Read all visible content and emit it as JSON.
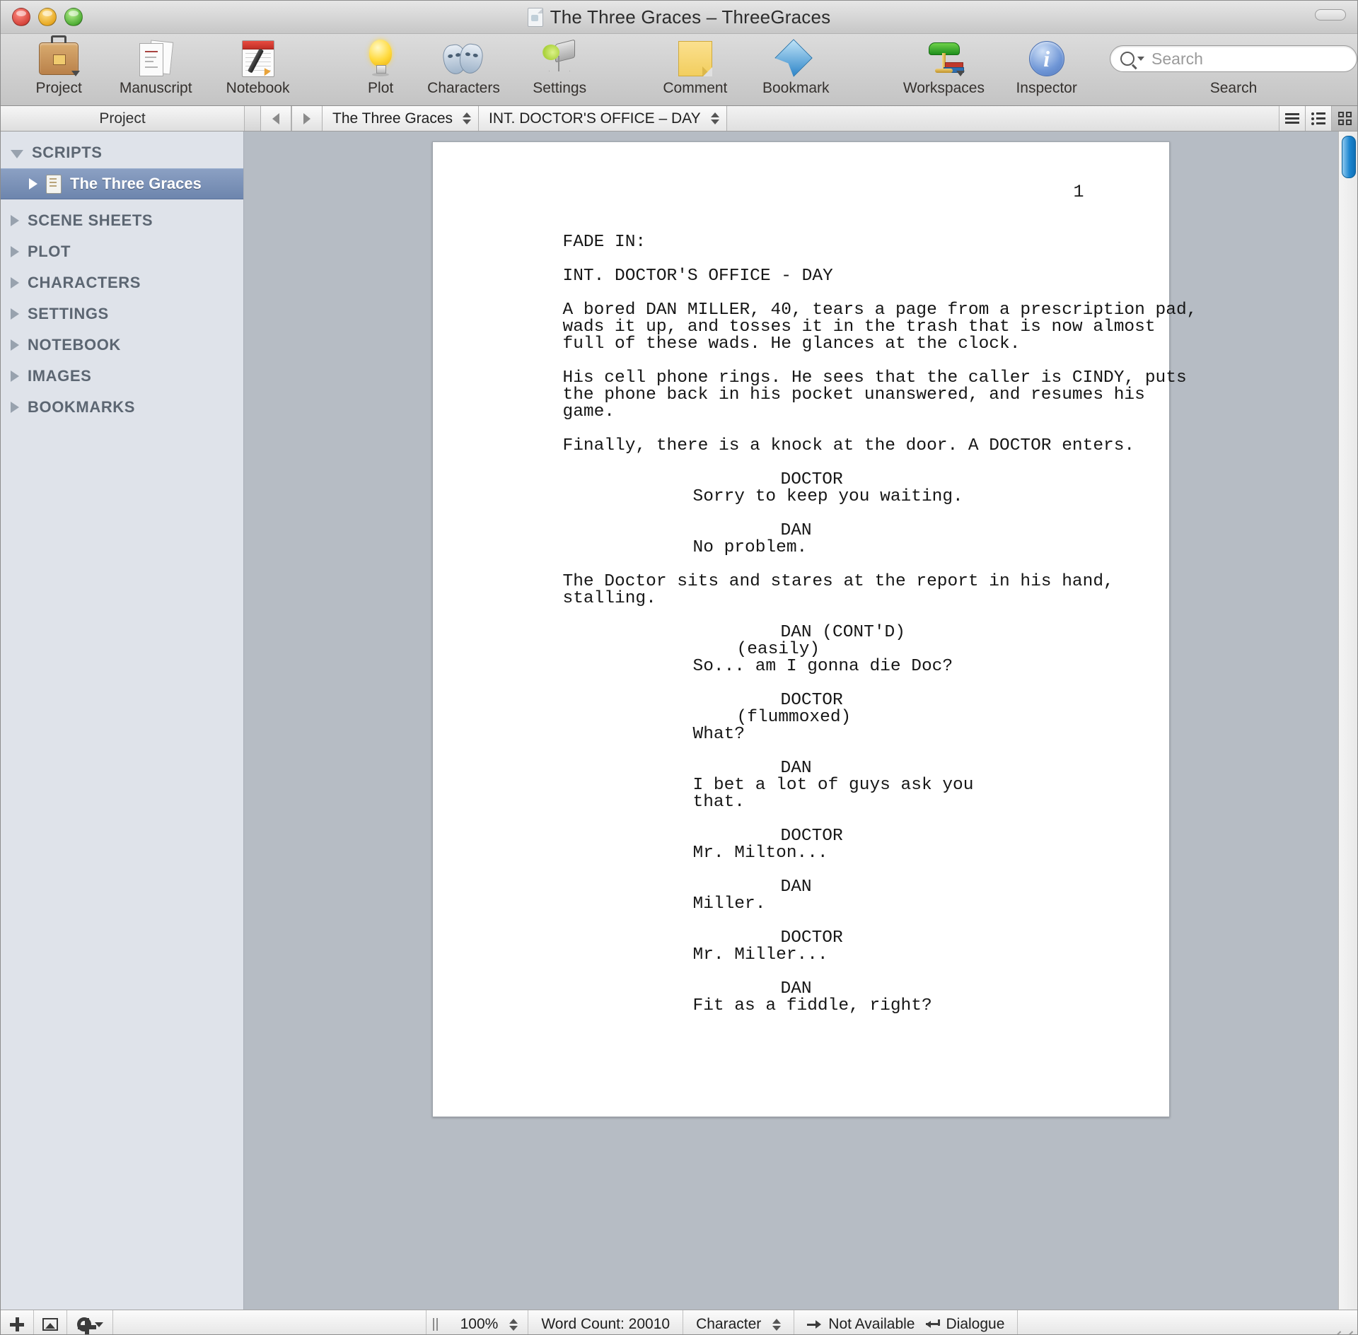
{
  "window": {
    "title": "The Three Graces – ThreeGraces",
    "controls": [
      "close",
      "minimize",
      "zoom"
    ]
  },
  "toolbar": {
    "items": [
      {
        "label": "Project",
        "icon": "briefcase-icon",
        "has_menu": true
      },
      {
        "label": "Manuscript",
        "icon": "manuscript-icon",
        "has_menu": false
      },
      {
        "label": "Notebook",
        "icon": "notebook-icon",
        "has_menu": false
      },
      {
        "label": "Plot",
        "icon": "lightbulb-icon",
        "has_menu": false
      },
      {
        "label": "Characters",
        "icon": "masks-icon",
        "has_menu": false
      },
      {
        "label": "Settings",
        "icon": "stage-light-icon",
        "has_menu": false
      },
      {
        "label": "Comment",
        "icon": "sticky-note-icon",
        "has_menu": false
      },
      {
        "label": "Bookmark",
        "icon": "bookmark-icon",
        "has_menu": false
      },
      {
        "label": "Workspaces",
        "icon": "desk-lamp-icon",
        "has_menu": true
      },
      {
        "label": "Inspector",
        "icon": "info-icon",
        "has_menu": false
      }
    ],
    "search": {
      "label": "Search",
      "placeholder": "Search",
      "value": "",
      "icon": "search-icon"
    }
  },
  "sidebar": {
    "header": "Project",
    "groups": [
      {
        "label": "SCRIPTS",
        "expanded": true,
        "selected_child": "The Three Graces"
      },
      {
        "label": "SCENE SHEETS",
        "expanded": false
      },
      {
        "label": "PLOT",
        "expanded": false
      },
      {
        "label": "CHARACTERS",
        "expanded": false
      },
      {
        "label": "SETTINGS",
        "expanded": false
      },
      {
        "label": "NOTEBOOK",
        "expanded": false
      },
      {
        "label": "IMAGES",
        "expanded": false
      },
      {
        "label": "BOOKMARKS",
        "expanded": false
      }
    ],
    "script_item": "The Three Graces"
  },
  "navbar": {
    "back_icon": "chevron-left-icon",
    "forward_icon": "chevron-right-icon",
    "document_popup": "The Three Graces",
    "scene_popup": "INT. DOCTOR'S OFFICE – DAY",
    "view_modes": [
      {
        "name": "page-view",
        "active": false
      },
      {
        "name": "outline-view",
        "active": false
      },
      {
        "name": "index-card-view",
        "active": true
      }
    ]
  },
  "editor": {
    "page_number": "1",
    "script": [
      {
        "type": "trans",
        "text": "FADE IN:"
      },
      {
        "type": "slug",
        "text": "INT. DOCTOR'S OFFICE - DAY"
      },
      {
        "type": "action",
        "text": "A bored DAN MILLER, 40, tears a page from a prescription pad,\nwads it up, and tosses it in the trash that is now almost\nfull of these wads. He glances at the clock."
      },
      {
        "type": "action",
        "text": "His cell phone rings. He sees that the caller is CINDY, puts\nthe phone back in his pocket unanswered, and resumes his\ngame."
      },
      {
        "type": "action",
        "text": "Finally, there is a knock at the door. A DOCTOR enters."
      },
      {
        "type": "cue",
        "text": "DOCTOR"
      },
      {
        "type": "dial",
        "text": "Sorry to keep you waiting."
      },
      {
        "type": "cue",
        "text": "DAN"
      },
      {
        "type": "dial",
        "text": "No problem."
      },
      {
        "type": "action",
        "text": "The Doctor sits and stares at the report in his hand,\nstalling."
      },
      {
        "type": "cue",
        "text": "DAN (CONT'D)"
      },
      {
        "type": "paren",
        "text": "(easily)"
      },
      {
        "type": "dial",
        "text": "So... am I gonna die Doc?"
      },
      {
        "type": "cue",
        "text": "DOCTOR"
      },
      {
        "type": "paren",
        "text": "(flummoxed)"
      },
      {
        "type": "dial",
        "text": "What?"
      },
      {
        "type": "cue",
        "text": "DAN"
      },
      {
        "type": "dial",
        "text": "I bet a lot of guys ask you\nthat."
      },
      {
        "type": "cue",
        "text": "DOCTOR"
      },
      {
        "type": "dial",
        "text": "Mr. Milton..."
      },
      {
        "type": "cue",
        "text": "DAN"
      },
      {
        "type": "dial",
        "text": "Miller."
      },
      {
        "type": "cue",
        "text": "DOCTOR"
      },
      {
        "type": "dial",
        "text": "Mr. Miller..."
      },
      {
        "type": "cue",
        "text": "DAN"
      },
      {
        "type": "dial",
        "text": "Fit as a fiddle, right?"
      }
    ]
  },
  "statusbar": {
    "add_label": "+",
    "zoom": "100%",
    "word_count": "Word Count: 20010",
    "element_popup": "Character",
    "tab_action": "Not Available",
    "return_action": "Dialogue"
  },
  "colors": {
    "selection_blue": "#6d85ad",
    "sidebar_bg": "#dfe3ea",
    "editor_bg": "#b6bcc4",
    "scrollbar_thumb": "#1d86d0"
  }
}
